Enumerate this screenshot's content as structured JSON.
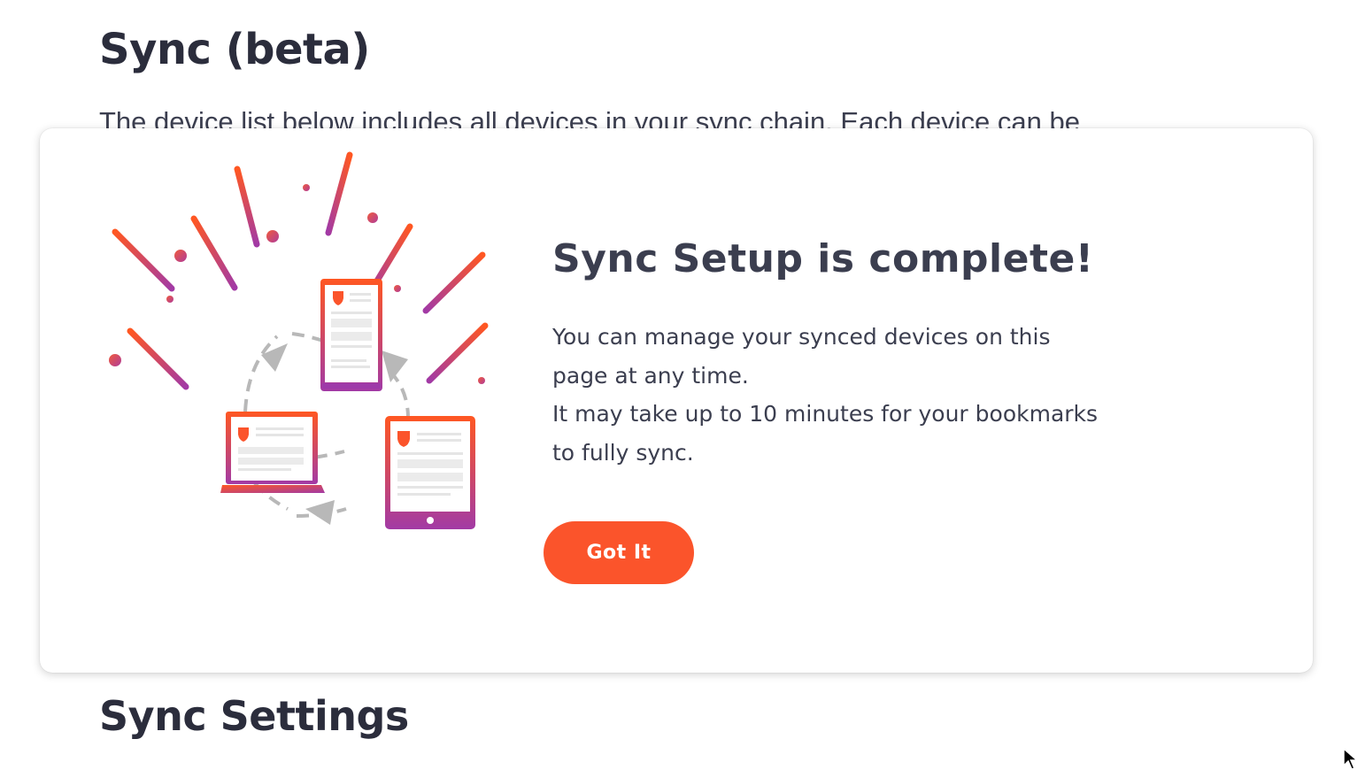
{
  "page": {
    "title": "Sync (beta)",
    "intro": "The device list below includes all devices in your sync chain. Each device can be",
    "settings_title": "Sync Settings"
  },
  "modal": {
    "heading": "Sync Setup is complete!",
    "body_line_1": "You can manage your synced devices on this page at any time.",
    "body_line_2": "It may take up to 10 minutes for your bookmarks to fully sync.",
    "button_label": "Got It"
  },
  "icons": {
    "illustration": "sync-devices-illustration",
    "cursor": "mouse-cursor-icon"
  },
  "colors": {
    "accent": "#fb542b",
    "gradient_start": "#ff5722",
    "gradient_end": "#9e3aa8",
    "text": "#2b2d3c"
  }
}
